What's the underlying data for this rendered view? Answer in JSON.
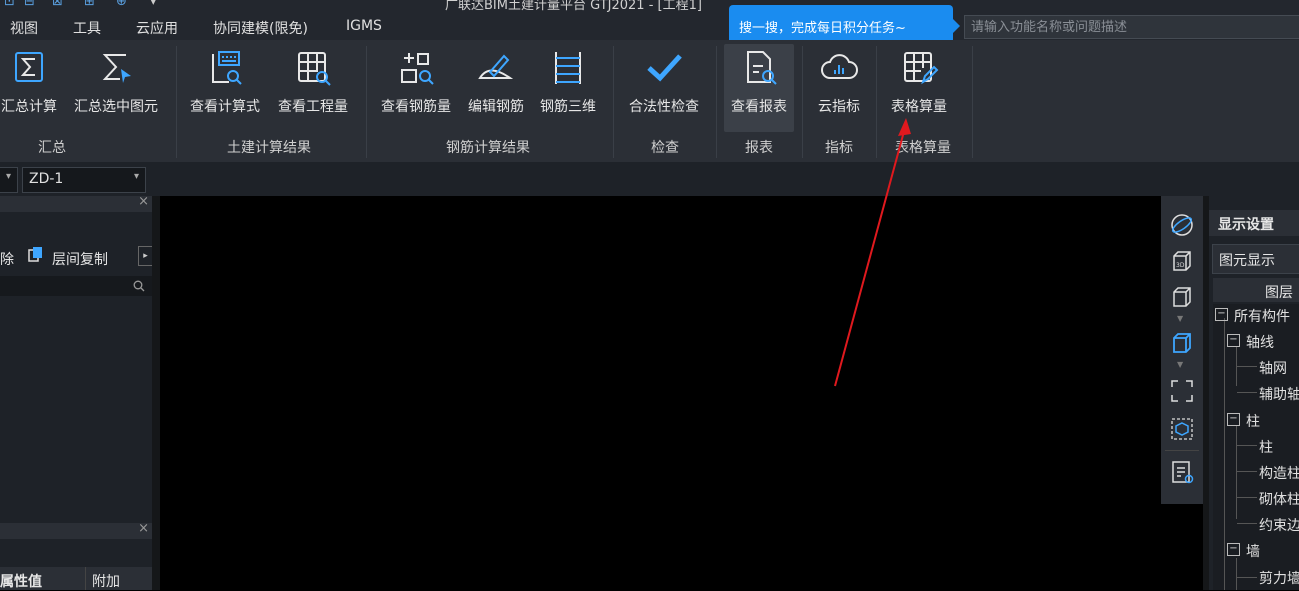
{
  "window": {
    "title": "广联达BIM土建计量平台 GTJ2021 - [工程1]"
  },
  "menu": {
    "items": [
      "视图",
      "工具",
      "云应用",
      "协同建模(限免)",
      "IGMS"
    ]
  },
  "ribbon": {
    "buttons": [
      {
        "label": "汇总计算",
        "icon": "sigma-icon"
      },
      {
        "label": "汇总选中图元",
        "icon": "sigma-select-icon"
      },
      {
        "label": "查看计算式",
        "icon": "view-formula-icon"
      },
      {
        "label": "查看工程量",
        "icon": "view-quantity-icon"
      },
      {
        "label": "查看钢筋量",
        "icon": "view-rebar-icon"
      },
      {
        "label": "编辑钢筋",
        "icon": "edit-rebar-icon"
      },
      {
        "label": "钢筋三维",
        "icon": "rebar-3d-icon"
      },
      {
        "label": "合法性检查",
        "icon": "check-icon"
      },
      {
        "label": "查看报表",
        "icon": "report-icon"
      },
      {
        "label": "云指标",
        "icon": "cloud-index-icon"
      },
      {
        "label": "表格算量",
        "icon": "table-edit-icon"
      }
    ],
    "groups": [
      "汇总",
      "土建计算结果",
      "钢筋计算结果",
      "检查",
      "报表",
      "指标",
      "表格算量"
    ]
  },
  "tooltip": {
    "text": "搜一搜，完成每日积分任务~"
  },
  "search": {
    "placeholder": "请输入功能名称或问题描述"
  },
  "combo": {
    "value": "ZD-1"
  },
  "left_panel": {
    "delete_label": "除",
    "copy_label": "层间复制",
    "prop_header": "属性值",
    "extra_header": "附加"
  },
  "right_panel": {
    "title": "显示设置",
    "tab": "图元显示",
    "column": "图层",
    "tree": [
      {
        "label": "所有构件",
        "level": 0,
        "expand": "−"
      },
      {
        "label": "轴线",
        "level": 1,
        "expand": "−"
      },
      {
        "label": "轴网",
        "level": 2
      },
      {
        "label": "辅助轴",
        "level": 2
      },
      {
        "label": "柱",
        "level": 1,
        "expand": "−"
      },
      {
        "label": "柱",
        "level": 2
      },
      {
        "label": "构造柱",
        "level": 2
      },
      {
        "label": "砌体柱",
        "level": 2
      },
      {
        "label": "约束边",
        "level": 2
      },
      {
        "label": "墙",
        "level": 1,
        "expand": "−"
      },
      {
        "label": "剪力墙",
        "level": 2
      }
    ]
  },
  "colors": {
    "accent": "#3ea6ff",
    "tooltip": "#1a8cf0",
    "annotation": "#e0191e"
  }
}
